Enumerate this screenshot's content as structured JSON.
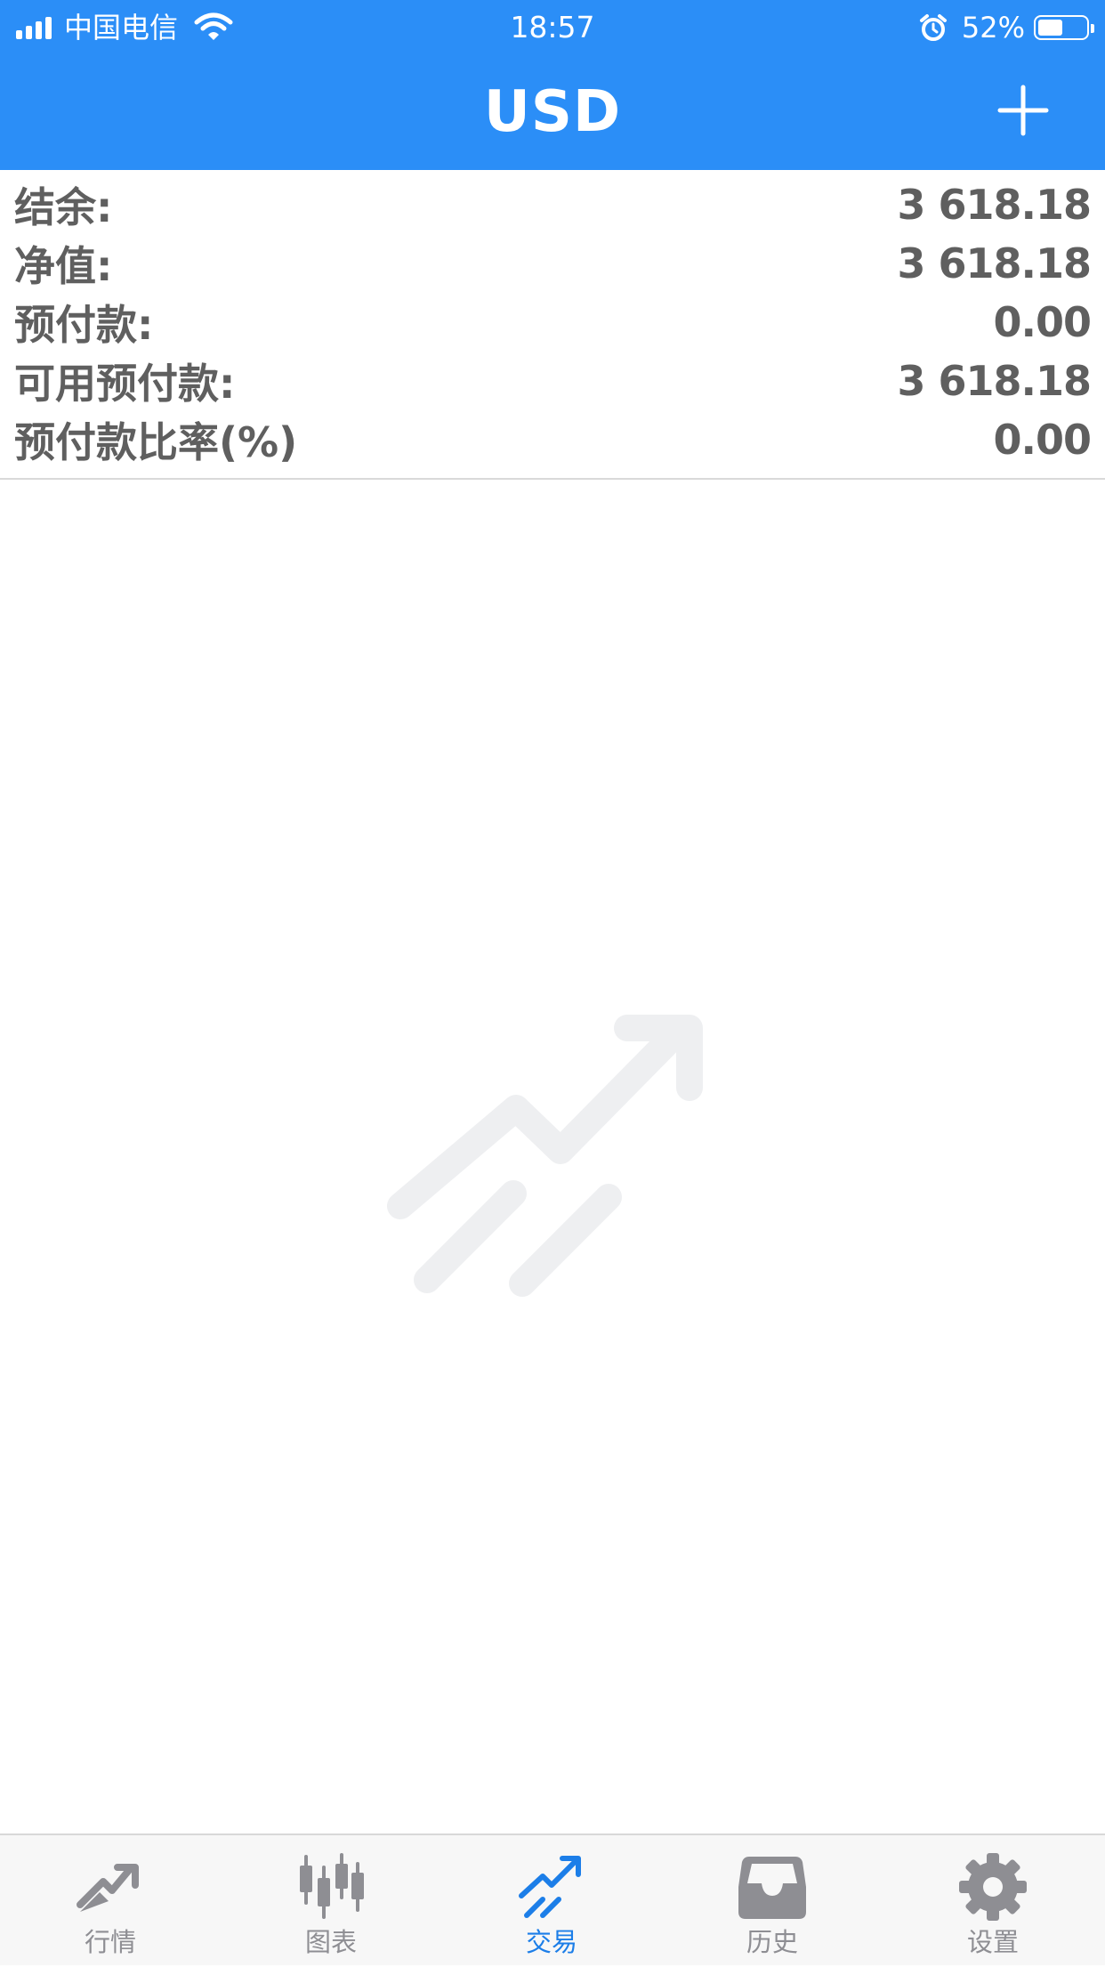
{
  "status_bar": {
    "carrier": "中国电信",
    "time": "18:57",
    "battery": "52%",
    "battery_level": 0.52
  },
  "nav": {
    "title": "USD",
    "add_icon": "plus-icon"
  },
  "account": [
    {
      "label": "结余:",
      "value": "3 618.18"
    },
    {
      "label": "净值:",
      "value": "3 618.18"
    },
    {
      "label": "预付款:",
      "value": "0.00"
    },
    {
      "label": "可用预付款:",
      "value": "3 618.18"
    },
    {
      "label": "预付款比率(%)",
      "value": "0.00"
    }
  ],
  "empty_state": {
    "icon": "trade-trend-icon"
  },
  "tabs": [
    {
      "label": "行情",
      "icon": "quotes-icon",
      "active": false
    },
    {
      "label": "图表",
      "icon": "candlestick-chart-icon",
      "active": false
    },
    {
      "label": "交易",
      "icon": "trade-icon",
      "active": true
    },
    {
      "label": "历史",
      "icon": "inbox-history-icon",
      "active": false
    },
    {
      "label": "设置",
      "icon": "gear-icon",
      "active": false
    }
  ],
  "colors": {
    "accent": "#2b8ef7",
    "active_tab": "#1c7ee8",
    "inactive_tab": "#8e8e93",
    "text": "#5f5f5f"
  }
}
